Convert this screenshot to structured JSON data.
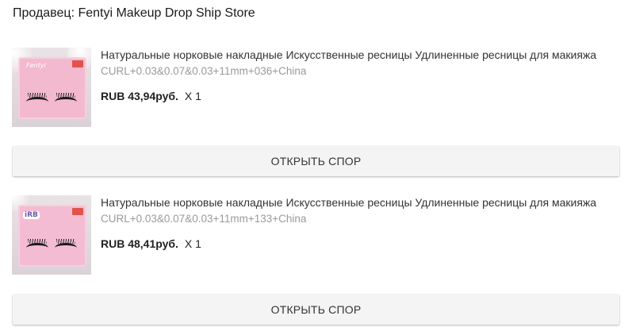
{
  "seller": {
    "label": "Продавец: Fentyi Makeup Drop Ship Store"
  },
  "items": [
    {
      "image_icon": "eyelash-product-image",
      "brand_text": "Fentyi",
      "title": "Натуральные норковые накладные Искусственные ресницы Удлиненные ресницы для макияжа",
      "sku": "CURL+0.03&0.07&0.03+11mm+036+China",
      "price": "RUB 43,94руб.",
      "quantity": "X 1",
      "dispute_button": "ОТКРЫТЬ СПОР"
    },
    {
      "image_icon": "eyelash-product-image",
      "brand_text": "iRB",
      "title": "Натуральные норковые накладные Искусственные ресницы Удлиненные ресницы для макияжа",
      "sku": "CURL+0.03&0.07&0.03+11mm+133+China",
      "price": "RUB 48,41руб.",
      "quantity": "X 1",
      "dispute_button": "ОТКРЫТЬ СПОР"
    }
  ],
  "colors": {
    "box_pink": "#f3b9cf",
    "button_bg": "#f4f4f4",
    "muted_text": "#9a9a9a"
  }
}
